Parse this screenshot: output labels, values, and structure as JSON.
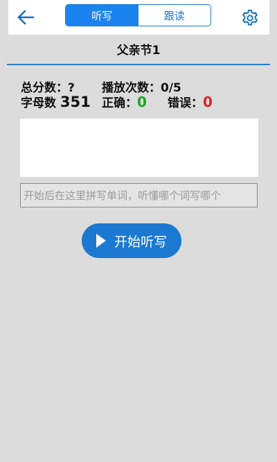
{
  "header": {
    "tabs": [
      {
        "label": "听写",
        "active": true
      },
      {
        "label": "跟读",
        "active": false
      }
    ],
    "back_icon": "arrow-left-icon",
    "settings_icon": "gear-icon"
  },
  "lesson": {
    "title": "父亲节1"
  },
  "stats": {
    "total_score_label": "总分数：",
    "total_score_value": "?",
    "play_count_label": "播放次数：",
    "play_count_value": "0/5",
    "letter_count_label": "字母数",
    "letter_count_value": "351",
    "correct_label": "正确：",
    "correct_value": "0",
    "wrong_label": "错误：",
    "wrong_value": "0"
  },
  "input": {
    "placeholder": "开始后在这里拼写单词，听懂哪个词写哪个"
  },
  "actions": {
    "start_label": "开始听写"
  },
  "colors": {
    "accent": "#1b83ee",
    "correct": "#1aa52a",
    "wrong": "#d8242a",
    "background": "#dcdcdc"
  }
}
